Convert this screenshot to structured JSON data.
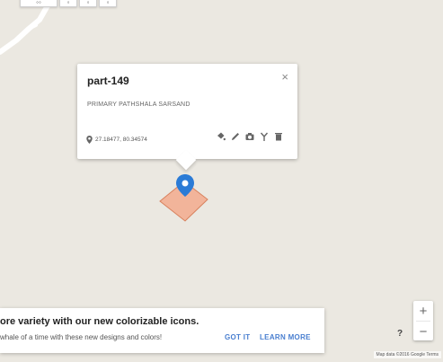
{
  "toolbar": {
    "buttons": [
      "◦◦",
      "◦",
      "◦",
      "◦"
    ]
  },
  "card": {
    "title": "part-149",
    "description": "PRIMARY PATHSHALA SARSAND",
    "coordinates": "27.18477, 80.34574",
    "actions": [
      "paint-bucket-icon",
      "pencil-icon",
      "camera-icon",
      "branch-icon",
      "trash-icon"
    ],
    "close_label": "×"
  },
  "map": {
    "feature_color": "#f2b49a",
    "feature_stroke": "#d8815d",
    "marker_color": "#2b7bd6",
    "road_color": "#ffffff"
  },
  "zoom": {
    "in_label": "+",
    "out_label": "−"
  },
  "help_label": "?",
  "attribution": "Map data ©2016 Google  Terms",
  "banner": {
    "title": "ore variety with our new colorizable icons.",
    "body": "whale of a time with these new designs and colors!",
    "got_it": "GOT IT",
    "learn_more": "LEARN MORE"
  }
}
